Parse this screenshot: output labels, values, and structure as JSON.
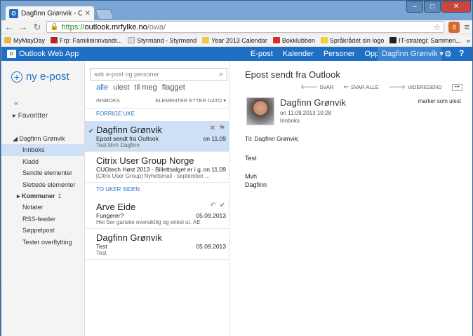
{
  "browser": {
    "tab_title": "Dagfinn Grønvik - Outlook",
    "tab_icon": "O",
    "close_glyph": "✕",
    "url_https": "https://",
    "url_host": "outlook.mrfylke.no",
    "url_path": "/owa/",
    "ext_label": "8",
    "bookmarks": [
      "MyMayDay",
      "Frp: Familieinnvandr...",
      "Styrmand - Styrmend",
      "Year 2013 Calendar",
      "Bokklubben",
      "Språkrådet sin logo",
      "IT-strategi: Sammen..."
    ],
    "more": "»"
  },
  "owa": {
    "app_icon": "O",
    "app_name": "Outlook Web App",
    "nav": [
      "E-post",
      "Kalender",
      "Personer",
      "Oppgaver"
    ],
    "user": "Dagfinn Grønvik ▾",
    "help": "?"
  },
  "left": {
    "new_mail_plus": "+",
    "new_mail": "ny e-post",
    "collapse": "«",
    "favorites": "▸ Favoritter",
    "root": "◢ Dagfinn Grønvik",
    "folders": [
      "Innboks",
      "Kladd",
      "Sendte elementer",
      "Slettede elementer"
    ],
    "kommuner_label": "▸ Kommuner",
    "kommuner_count": "1",
    "folders2": [
      "Notater",
      "RSS-feeder",
      "Søppelpost",
      "Tester overflytting"
    ]
  },
  "list": {
    "search_placeholder": "søk e-post og personer",
    "filters": [
      "alle",
      "ulest",
      "til meg",
      "flagget"
    ],
    "sort_left": "INNBOKS",
    "sort_right": "ELEMENTER ETTER DATO ▾",
    "groups": [
      "FORRIGE UKE",
      "TO UKER SIDEN"
    ],
    "items": [
      {
        "from": "Dagfinn Grønvik",
        "subject": "Epost sendt fra Outlook",
        "date": "on 11.09",
        "preview": "Test  Mvh Dagfinn"
      },
      {
        "from": "Citrix User Group Norge",
        "subject": "CUGtech Høst 2013 - Billettsalget er i g.",
        "date": "on 11.09",
        "preview": "[Citrix User Group]  Nyhetsmail - september ..."
      },
      {
        "from": "Arve Eide",
        "subject": "Fungerer?",
        "date": "05.09.2013",
        "preview": "Hei  Ser ganske oversiktlig og enkel ut.  AE"
      },
      {
        "from": "Dagfinn Grønvik",
        "subject": "Test",
        "date": "05.09.2013",
        "preview": "Test"
      }
    ]
  },
  "reading": {
    "subject": "Epost sendt fra Outlook",
    "actions": [
      "SVAR",
      "SVAR ALLE",
      "VIDERESEND"
    ],
    "more": "•••",
    "sender": "Dagfinn Grønvik",
    "date": "on 11.09.2013 10:28",
    "folder": "Innboks",
    "mark_unread": "marker som ulest",
    "to": "Til:  Dagfinn Grønvik;",
    "body": [
      "Test",
      "Mvh",
      "Dagfinn"
    ]
  }
}
